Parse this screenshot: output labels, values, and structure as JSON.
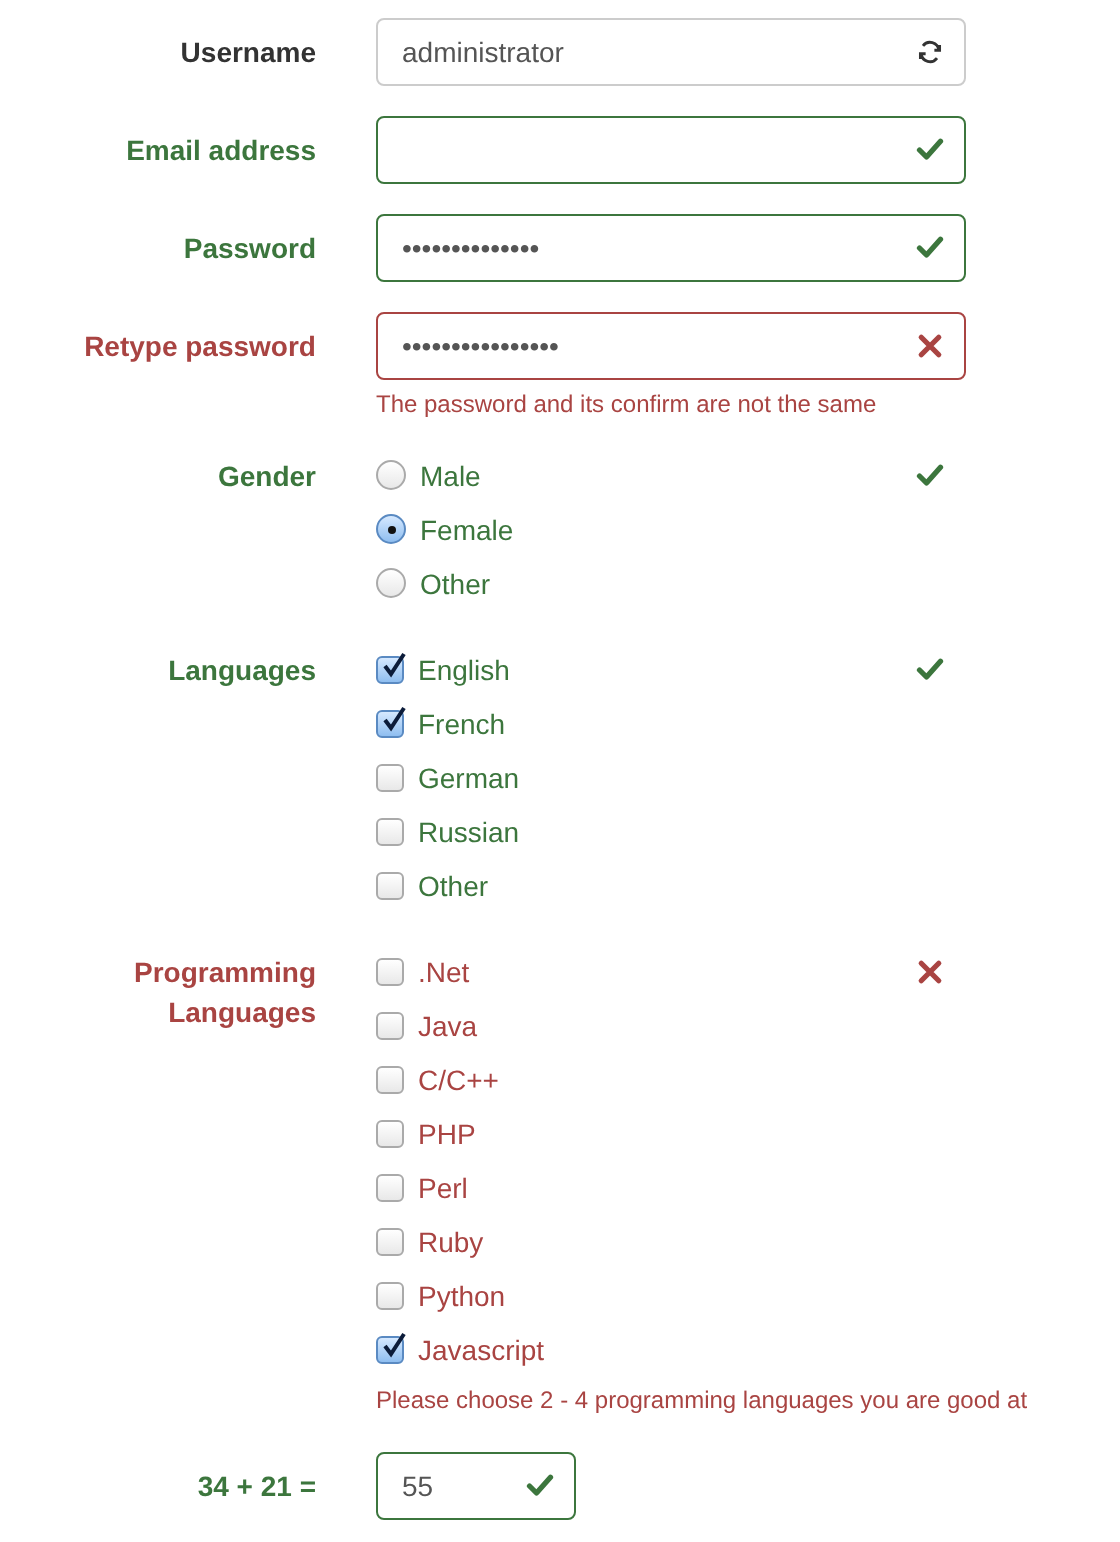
{
  "form": [
    {
      "kind": "text",
      "label": "Username",
      "value": "administrator",
      "feedback": {
        "kind": "refresh"
      }
    },
    {
      "kind": "text",
      "label": "Email address",
      "valid": true,
      "feedback": {
        "kind": "check"
      }
    },
    {
      "kind": "text",
      "label": "Password",
      "value": "••••••••••••••",
      "valid": true,
      "feedback": {
        "kind": "check"
      }
    },
    {
      "kind": "text",
      "label": "Retype password",
      "value": "••••••••••••••••",
      "valid": false,
      "feedback": {
        "kind": "cross"
      },
      "help": "The password and its confirm are not the same"
    },
    {
      "kind": "radio",
      "label": "Gender",
      "valid": true,
      "feedback": {
        "kind": "check"
      },
      "options": [
        {
          "label": "Male",
          "selected": false
        },
        {
          "label": "Female",
          "selected": true
        },
        {
          "label": "Other",
          "selected": false
        }
      ]
    },
    {
      "kind": "checkbox",
      "label": "Languages",
      "valid": true,
      "feedback": {
        "kind": "check"
      },
      "options": [
        {
          "label": "English",
          "checked": true
        },
        {
          "label": "French",
          "checked": true
        },
        {
          "label": "German",
          "checked": false
        },
        {
          "label": "Russian",
          "checked": false
        },
        {
          "label": "Other",
          "checked": false
        }
      ]
    },
    {
      "kind": "checkbox",
      "label": "Programming Languages",
      "valid": false,
      "feedback": {
        "kind": "cross"
      },
      "help": "Please choose 2 - 4 programming languages you are good at",
      "options": [
        {
          "label": ".Net",
          "checked": false
        },
        {
          "label": "Java",
          "checked": false
        },
        {
          "label": "C/C++",
          "checked": false
        },
        {
          "label": "PHP",
          "checked": false
        },
        {
          "label": "Perl",
          "checked": false
        },
        {
          "label": "Ruby",
          "checked": false
        },
        {
          "label": "Python",
          "checked": false
        },
        {
          "label": "Javascript",
          "checked": true
        }
      ]
    },
    {
      "kind": "short-text",
      "label": "34 + 21 =",
      "value": "55",
      "valid": true,
      "feedback": {
        "kind": "check"
      }
    }
  ]
}
